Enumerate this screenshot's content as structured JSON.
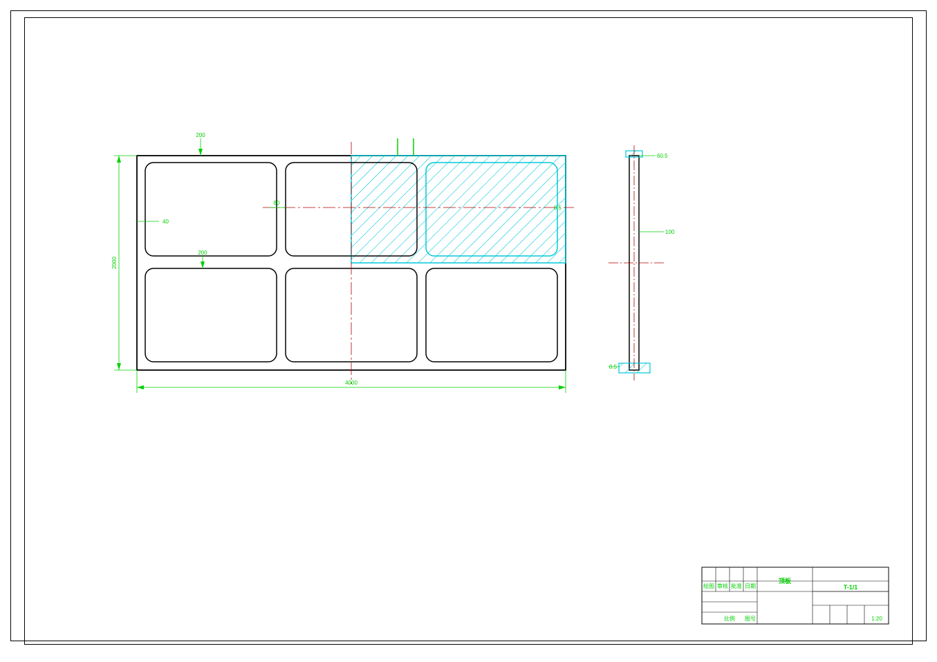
{
  "drawing": {
    "part_name": "顶板",
    "sheet": "T-1/1",
    "dimensions": {
      "width_overall": "4000",
      "height_overall": "2000",
      "dim_40": "40",
      "dim_80": "80",
      "dim_200": "200",
      "dim_100": "100",
      "dim_0_5": "0.5",
      "dim_60_5": "60.5"
    },
    "title_block": {
      "label_scale": "比例",
      "label_drawn": "绘图",
      "label_check": "审核",
      "label_approve": "批准",
      "label_date": "日期",
      "label_sheet": "图号",
      "scale": "1:20"
    }
  }
}
